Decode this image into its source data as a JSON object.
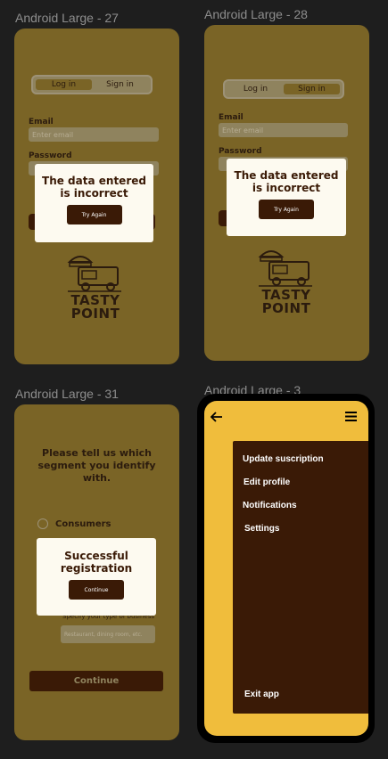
{
  "frames": {
    "f27": "Android Large - 27",
    "f28": "Android Large - 28",
    "f31": "Android Large - 31",
    "f3": "Android Large - 3"
  },
  "login": {
    "tab_login": "Log in",
    "tab_signin": "Sign in",
    "email_label": "Email",
    "email_placeholder": "Enter email",
    "password_label": "Password"
  },
  "error_modal": {
    "title": "The data entered is incorrect",
    "button": "Try Again"
  },
  "logo": {
    "line1": "TASTY",
    "line2": "POINT"
  },
  "segment": {
    "heading": "Please tell us which segment you identify with.",
    "option_consumers": "Consumers",
    "business_label": "Specify your type of business",
    "business_placeholder": "Restaurant, dining room, etc.",
    "continue": "Continue"
  },
  "success_modal": {
    "title": "Successful registration",
    "button": "Continue"
  },
  "menu": {
    "items": [
      "Update suscription",
      "Edit profile",
      "Notifications",
      "Settings"
    ],
    "exit": "Exit app",
    "back_icon": "arrow-left-icon",
    "menu_icon": "hamburger-icon"
  },
  "colors": {
    "dim_yellow": "#7a6426",
    "bright_yellow": "#f0bd3c",
    "dark_brown": "#3a1a06",
    "modal_bg": "#fdfaf0"
  }
}
